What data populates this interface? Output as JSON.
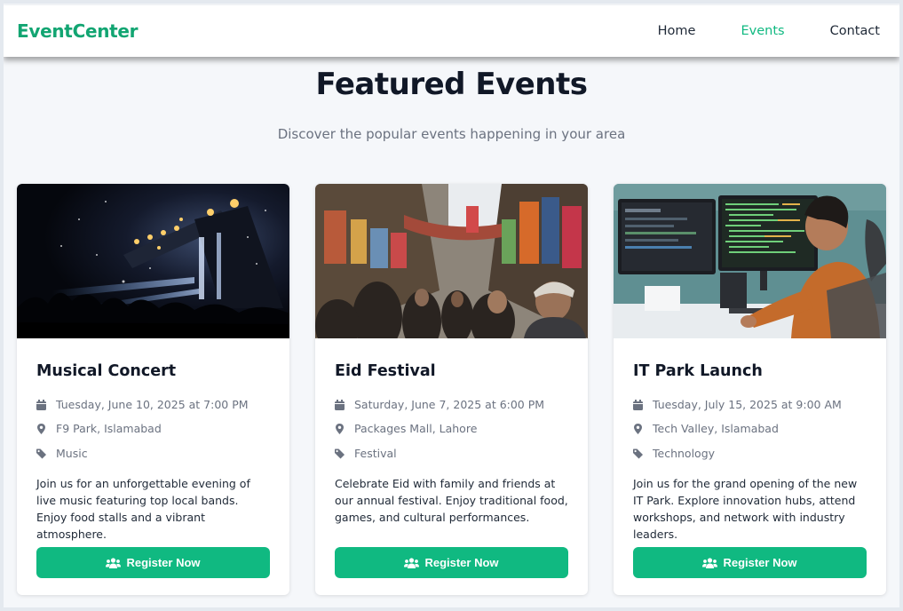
{
  "navbar": {
    "brand": "EventCenter",
    "links": [
      {
        "label": "Home",
        "active": false
      },
      {
        "label": "Events",
        "active": true
      },
      {
        "label": "Contact",
        "active": false
      }
    ]
  },
  "header": {
    "title": "Featured Events",
    "subtitle": "Discover the popular events happening in your area"
  },
  "colors": {
    "brand": "#12a572",
    "accent": "#10b981",
    "muted": "#6b7280",
    "meta_icon": "#6b7280"
  },
  "events": [
    {
      "title": "Musical Concert",
      "date": "Tuesday, June 10, 2025 at 7:00 PM",
      "location": "F9 Park, Islamabad",
      "category": "Music",
      "description": "Join us for an unforgettable evening of live music featuring top local bands. Enjoy food stalls and a vibrant atmosphere.",
      "button": "Register Now",
      "image": "concert-stage-photo"
    },
    {
      "title": "Eid Festival",
      "date": "Saturday, June 7, 2025 at 6:00 PM",
      "location": "Packages Mall, Lahore",
      "category": "Festival",
      "description": "Celebrate Eid with family and friends at our annual festival. Enjoy traditional food, games, and cultural performances.",
      "button": "Register Now",
      "image": "bazaar-market-photo"
    },
    {
      "title": "IT Park Launch",
      "date": "Tuesday, July 15, 2025 at 9:00 AM",
      "location": "Tech Valley, Islamabad",
      "category": "Technology",
      "description": "Join us for the grand opening of the new IT Park. Explore innovation hubs, attend workshops, and network with industry leaders.",
      "button": "Register Now",
      "image": "developer-workstation-photo"
    }
  ],
  "icons": {
    "date": "calendar-icon",
    "location": "map-pin-icon",
    "category": "tag-icon",
    "button": "users-icon"
  }
}
